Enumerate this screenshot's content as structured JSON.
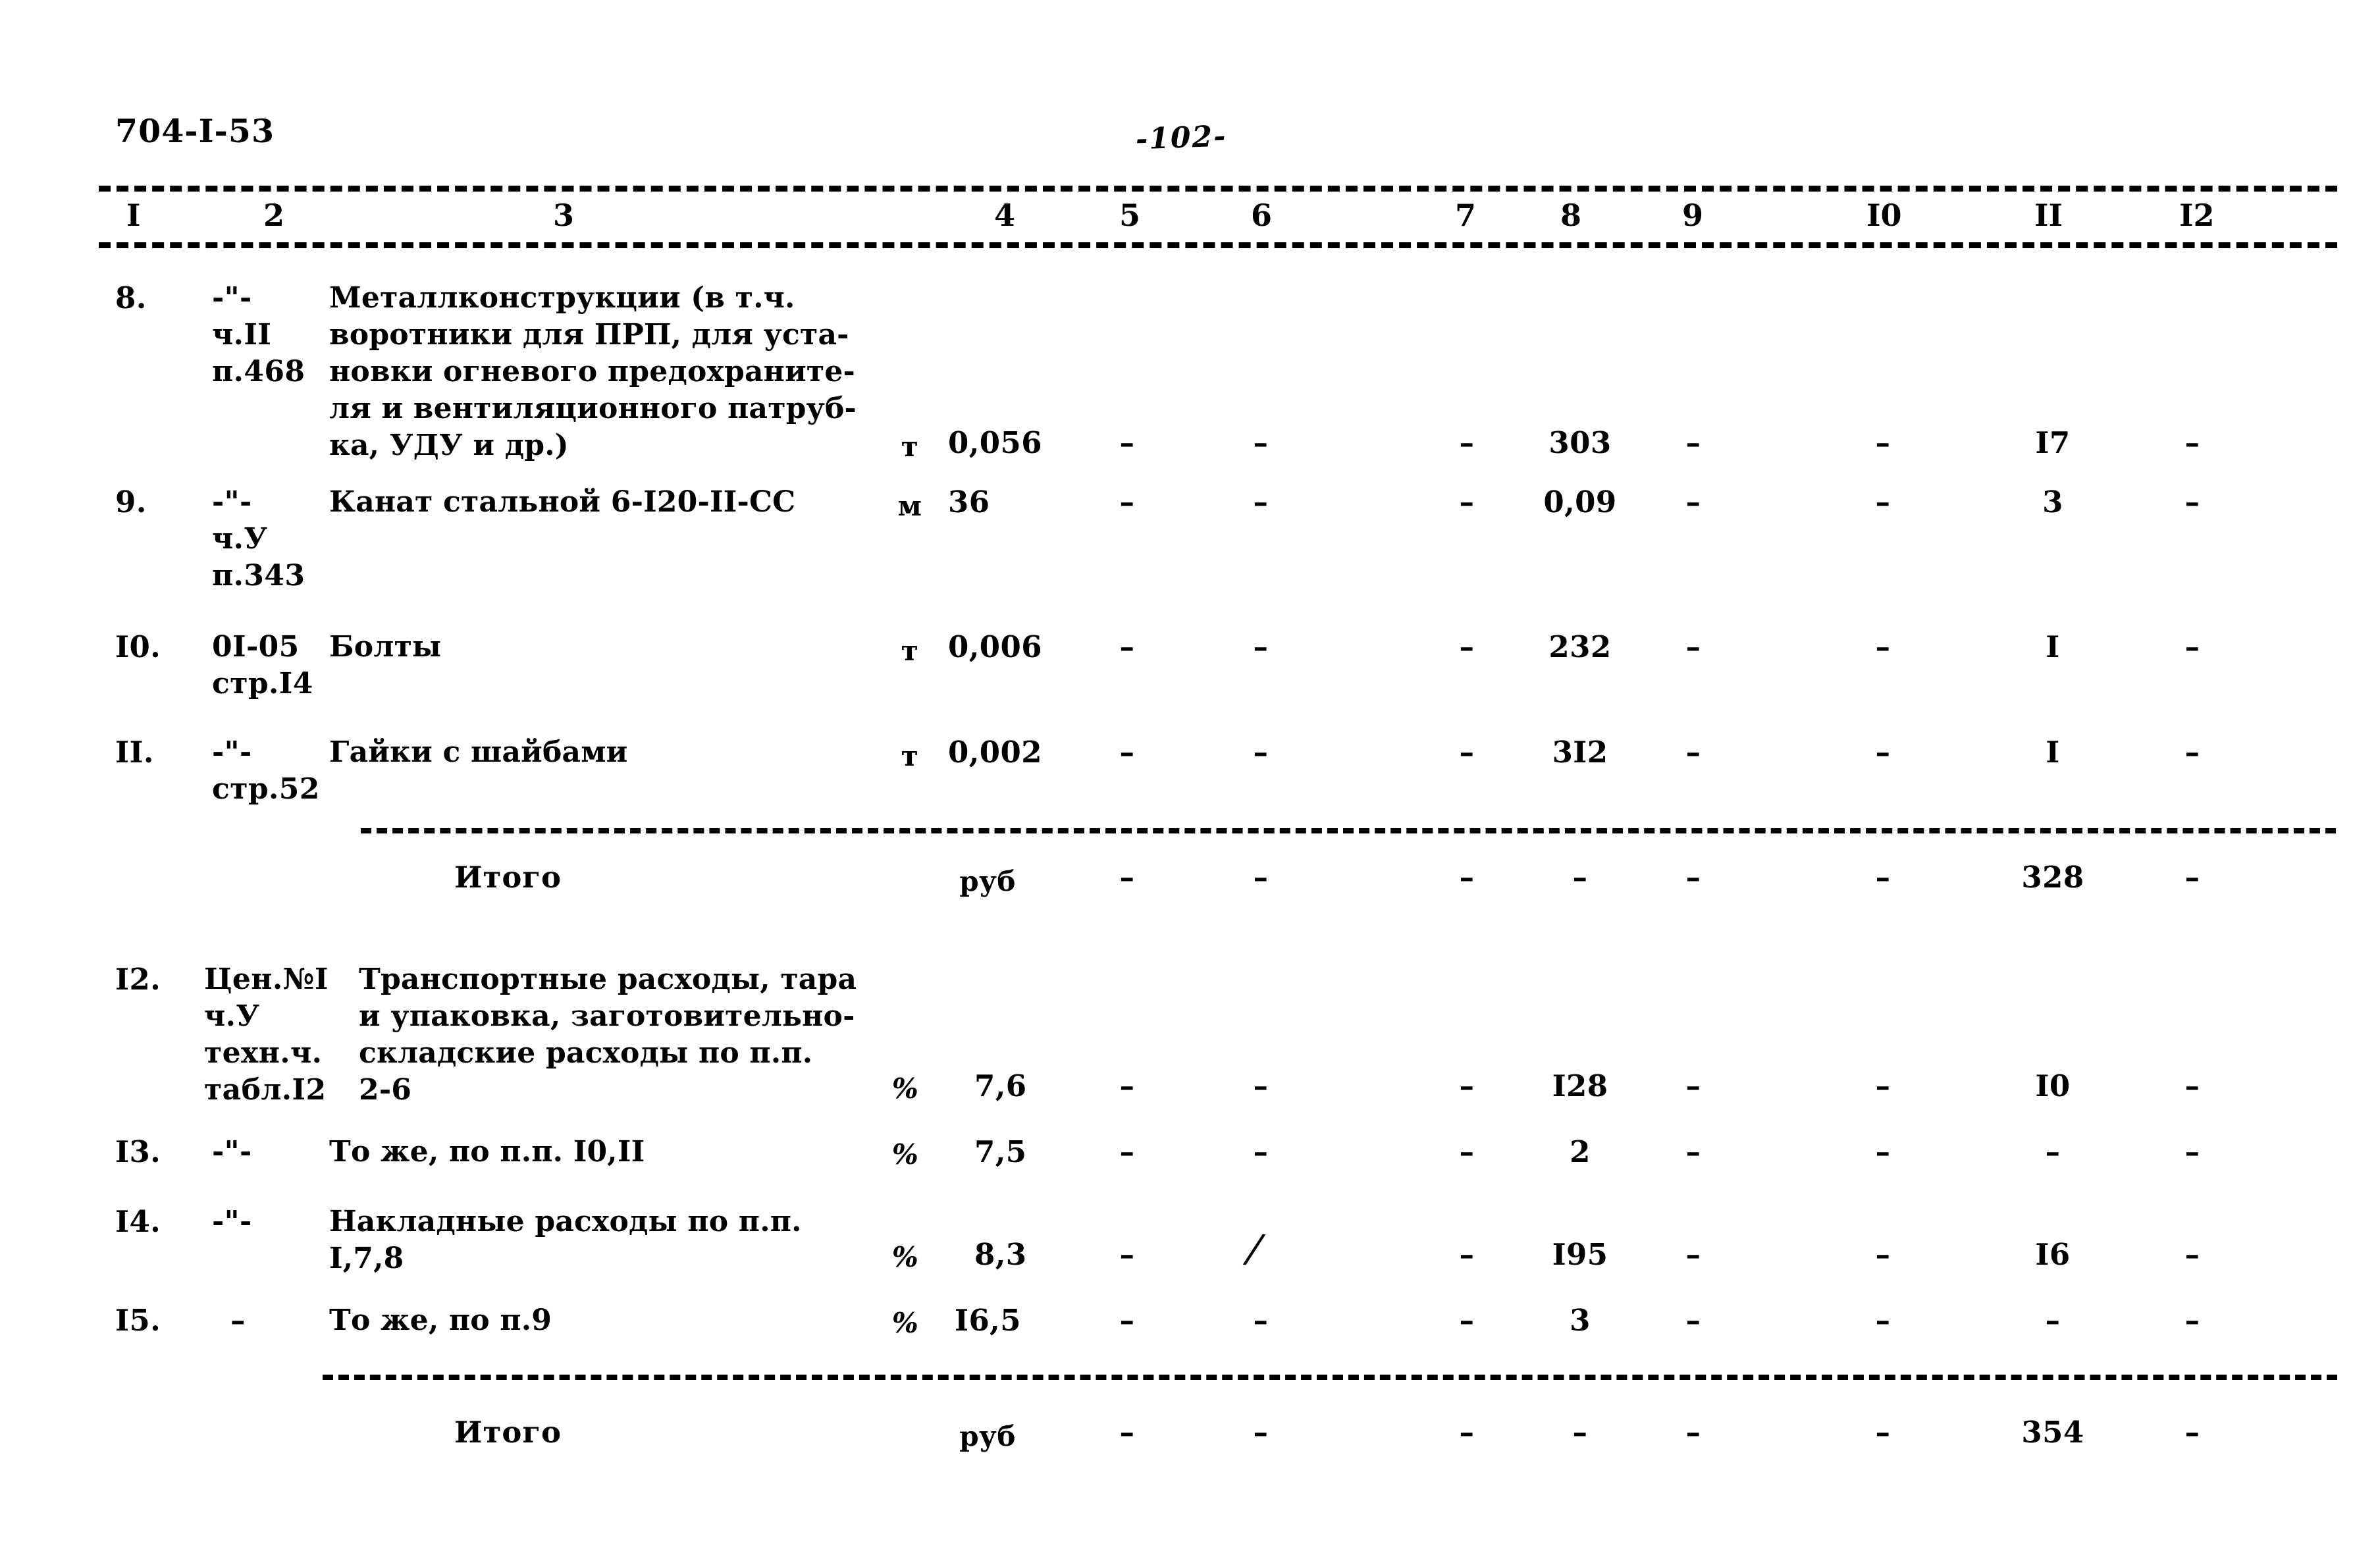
{
  "header": {
    "doc_id": "704-I-53",
    "page_number": "-102-"
  },
  "table": {
    "column_numbers": [
      "I",
      "2",
      "3",
      "4",
      "5",
      "6",
      "7",
      "8",
      "9",
      "I0",
      "II",
      "I2"
    ],
    "rows": [
      {
        "no": "8.",
        "ref_lines": [
          "-\"-",
          "ч.II",
          "п.468"
        ],
        "desc_lines": [
          "Металлконструкции (в т.ч.",
          "воротники для ПРП, для уста-",
          "новки огневого предохраните-",
          "ля и вентиляционного патруб-",
          "ка, УДУ и др.)"
        ],
        "unit": "т",
        "c4": "0,056",
        "c5": "–",
        "c6": "–",
        "c7": "–",
        "c8": "303",
        "c9": "–",
        "c10": "–",
        "c11": "I7",
        "c12": "–"
      },
      {
        "no": "9.",
        "ref_lines": [
          "-\"-",
          "ч.У",
          "п.343"
        ],
        "desc_lines": [
          "Канат стальной 6-I20-II-СС"
        ],
        "unit": "м",
        "c4": "36",
        "c5": "–",
        "c6": "–",
        "c7": "–",
        "c8": "0,09",
        "c9": "–",
        "c10": "–",
        "c11": "3",
        "c12": "–"
      },
      {
        "no": "I0.",
        "ref_lines": [
          "0I-05",
          "стр.I4"
        ],
        "desc_lines": [
          "Болты"
        ],
        "unit": "т",
        "c4": "0,006",
        "c5": "–",
        "c6": "–",
        "c7": "–",
        "c8": "232",
        "c9": "–",
        "c10": "–",
        "c11": "I",
        "c12": "–"
      },
      {
        "no": "II.",
        "ref_lines": [
          "-\"-",
          "стр.52"
        ],
        "desc_lines": [
          "Гайки с шайбами"
        ],
        "unit": "т",
        "c4": "0,002",
        "c5": "–",
        "c6": "–",
        "c7": "–",
        "c8": "3I2",
        "c9": "–",
        "c10": "–",
        "c11": "I",
        "c12": "–"
      },
      {
        "no": "I2.",
        "ref_lines": [
          "Цен.№I",
          "ч.У",
          "техн.ч.",
          "табл.I2"
        ],
        "desc_lines": [
          "Транспортные расходы, тара",
          "и упаковка, заготовительно-",
          "складские расходы по п.п.",
          "2-6"
        ],
        "unit": "%",
        "c4": "7,6",
        "c5": "–",
        "c6": "–",
        "c7": "–",
        "c8": "I28",
        "c9": "–",
        "c10": "–",
        "c11": "I0",
        "c12": "–"
      },
      {
        "no": "I3.",
        "ref_lines": [
          "-\"-"
        ],
        "desc_lines": [
          "То же, по п.п. I0,II"
        ],
        "unit": "%",
        "c4": "7,5",
        "c5": "–",
        "c6": "–",
        "c7": "–",
        "c8": "2",
        "c9": "–",
        "c10": "–",
        "c11": "–",
        "c12": "–"
      },
      {
        "no": "I4.",
        "ref_lines": [
          "-\"-"
        ],
        "desc_lines": [
          "Накладные расходы по п.п.",
          "I,7,8"
        ],
        "unit": "%",
        "c4": "8,3",
        "c5": "–",
        "c6": "/",
        "c7": "–",
        "c8": "I95",
        "c9": "–",
        "c10": "–",
        "c11": "I6",
        "c12": "–"
      },
      {
        "no": "I5.",
        "ref_lines": [
          "–"
        ],
        "desc_lines": [
          "То же, по п.9"
        ],
        "unit": "%",
        "c4": "I6,5",
        "c5": "–",
        "c6": "–",
        "c7": "–",
        "c8": "3",
        "c9": "–",
        "c10": "–",
        "c11": "–",
        "c12": "–"
      }
    ],
    "totals": [
      {
        "label": "Итого",
        "unit": "руб",
        "c5": "–",
        "c6": "–",
        "c7": "–",
        "c8": "–",
        "c9": "–",
        "c10": "–",
        "c11": "328",
        "c12": "–"
      },
      {
        "label": "Итого",
        "unit": "руб",
        "c5": "–",
        "c6": "–",
        "c7": "–",
        "c8": "–",
        "c9": "–",
        "c10": "–",
        "c11": "354",
        "c12": "–"
      }
    ]
  }
}
